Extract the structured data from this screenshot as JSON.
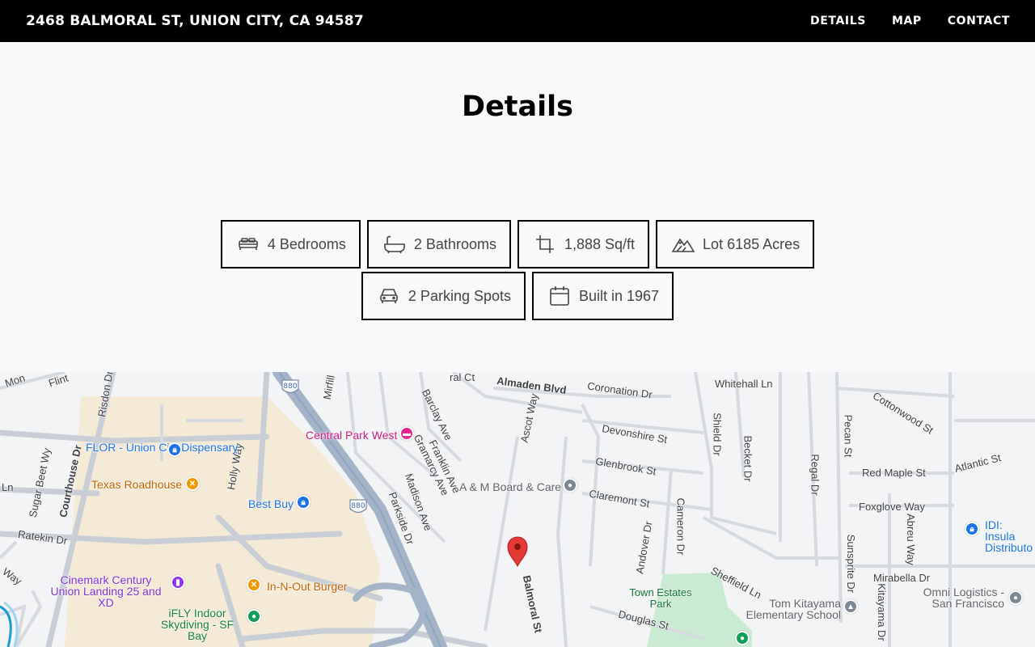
{
  "header": {
    "address": "2468 BALMORAL ST, UNION CITY, CA 94587",
    "nav": [
      "DETAILS",
      "MAP",
      "CONTACT"
    ]
  },
  "details": {
    "title": "Details",
    "features": [
      {
        "icon": "bed-icon",
        "label": "4 Bedrooms"
      },
      {
        "icon": "bathtub-icon",
        "label": "2 Bathrooms"
      },
      {
        "icon": "crop-icon",
        "label": "1,888 Sq/ft"
      },
      {
        "icon": "mountains-icon",
        "label": "Lot 6185 Acres"
      },
      {
        "icon": "car-icon",
        "label": "2 Parking Spots"
      },
      {
        "icon": "calendar-icon",
        "label": "Built in 1967"
      }
    ]
  },
  "map": {
    "streets": [
      "Almaden Blvd",
      "Coronation Dr",
      "Whitehall Ln",
      "Cottonwood St",
      "Devonshire St",
      "Glenbrook St",
      "Claremont St",
      "Cameron Dr",
      "Shield Dr",
      "Becket Dr",
      "Regal Dr",
      "Pecan St",
      "Red Maple St",
      "Atlantic St",
      "Foxglove Way",
      "Andover Dr",
      "Sheffield Ln",
      "Sunsprite Dr",
      "Abreu Way",
      "Mirabella Dr",
      "Kitayama Dr",
      "Douglas St",
      "Balmoral St",
      "Ascot Way",
      "Gramarcy Ave",
      "Franklin Ave",
      "Barclay Ave",
      "Madison Ave",
      "Parkside Dr",
      "Holly Way",
      "Courthouse Dr",
      "Sugar Beet Wy",
      "Ratekin Dr",
      "Risdon Dr",
      "Mirfill",
      "Flint",
      "Mon",
      "Ln",
      "Way",
      "ral Ct"
    ],
    "places": {
      "flor": "FLOR - Union City Dispensary",
      "texas": "Texas Roadhouse",
      "bestbuy": "Best Buy",
      "central_park": "Central Park West",
      "am_board": "A & M Board & Care",
      "cinemark": "Cinemark Century Union Landing 25 and XD",
      "innout": "In-N-Out Burger",
      "ifly": "iFLY Indoor Skydiving - SF Bay",
      "town_estates": "Town Estates Park",
      "tom_kitayama": "Tom Kitayama Elementary School",
      "omni": "Omni Logistics - San Francisco",
      "idi": "IDI: Insula Distributo"
    },
    "highway": "880"
  }
}
